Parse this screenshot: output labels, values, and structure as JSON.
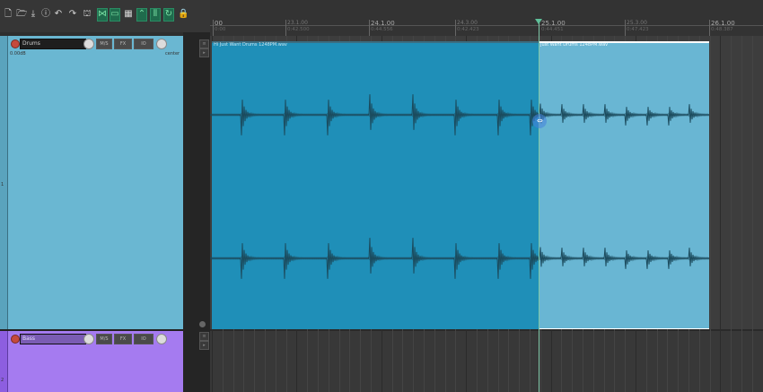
{
  "toolbar": {
    "icons": [
      "new-project-icon",
      "open-project-icon",
      "save-project-icon",
      "project-settings-icon",
      "undo-icon",
      "redo-icon",
      "metronome-icon",
      "snap-grid-icon",
      "ripple-icon",
      "grid-icon",
      "autofade-icon",
      "group-icon",
      "loop-icon",
      "lock-icon"
    ]
  },
  "ruler": {
    "marks": [
      {
        "bar": "00",
        "time": "0:00"
      },
      {
        "bar": "23.1.00",
        "time": "0:42.500"
      },
      {
        "bar": "24.1.00",
        "time": "0:44.556"
      },
      {
        "bar": "24.3.00",
        "time": "0:42.423"
      },
      {
        "bar": "25.1.00",
        "time": "0:44.451"
      },
      {
        "bar": "25.3.00",
        "time": "0:47.423"
      },
      {
        "bar": "26.1.00",
        "time": "0:48.387"
      }
    ]
  },
  "tracks": [
    {
      "number": "1",
      "name": "Drums",
      "volume": "0.00dB",
      "pan": "center",
      "color": "#6ab7d2"
    },
    {
      "number": "2",
      "name": "Bass",
      "color": "#a57bf0"
    }
  ],
  "items": [
    {
      "title": "Hi Just Want Drums 1248PM.wav",
      "color": "#1f8fb8"
    },
    {
      "title": "Just Want Drums 1248PM.wav",
      "color": "#69b6d3"
    }
  ],
  "colors": {
    "accent": "#5fc09a",
    "selected_item": "#69b6d3"
  }
}
